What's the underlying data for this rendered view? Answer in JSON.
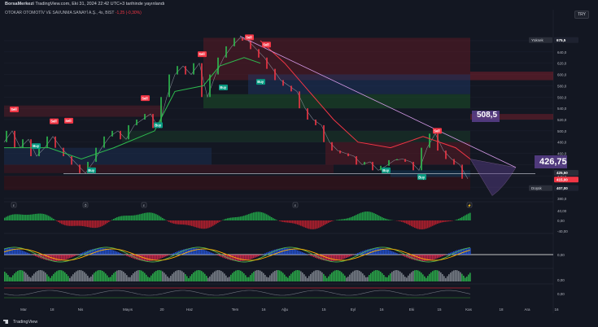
{
  "header": {
    "published_by": "BorsaMerkezi",
    "published_text": "TradingView.com, Eki 31, 2024 22:42 UTC+3 tarihinde yayınlandı",
    "symbol_text": "OTOKAR OTOMOTİV VE SAVUNMA SANAYİ A.Ş., 4s, BIST",
    "change_text": "-1,25 (-0,30%)",
    "currency_button": "TRY"
  },
  "price_axis": {
    "ticks": [
      "660,0",
      "640,0",
      "620,0",
      "600,0",
      "580,0",
      "560,0",
      "540,0",
      "520,0",
      "500,0",
      "480,0",
      "460,0",
      "440,0",
      "420,0",
      "400,0",
      "380,0"
    ],
    "high_label": "Yüksek",
    "high_value": "675,5",
    "low_label": "Düşük",
    "low_value": "407,00",
    "tag_425": "425,50",
    "tag_415": "415,00"
  },
  "annotations": {
    "target_upper": "508,5",
    "target_lower": "426,75",
    "buy_label": "Buy",
    "sell_label": "Sell"
  },
  "indicator_axes": {
    "osc1": [
      "40,00",
      "0,00",
      "-40,00"
    ],
    "osc2": [
      "0,00"
    ],
    "vol": [
      "0,00"
    ],
    "osc3": [
      "0,00"
    ]
  },
  "time_axis": [
    "Mar",
    "18",
    "Nis",
    "Mayıs",
    "20",
    "Haz",
    "Tem",
    "16",
    "Ağu",
    "15",
    "Eyl",
    "16",
    "Eki",
    "15",
    "Kas",
    "18",
    "Ara",
    "16"
  ],
  "colors": {
    "background": "#131722",
    "bull": "#2ebd4f",
    "bear": "#f23645",
    "trend_line": "#d59ae8",
    "target_box": "#5b3f8c"
  },
  "footer": {
    "brand": "TradingView"
  }
}
